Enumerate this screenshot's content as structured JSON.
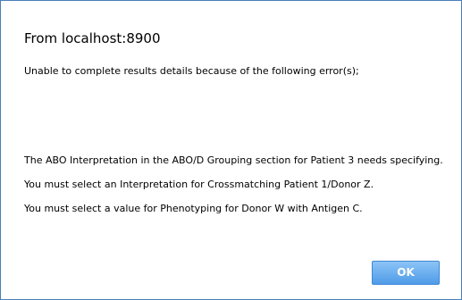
{
  "dialog": {
    "title": "From localhost:8900",
    "intro": "Unable to complete results details because of the following error(s);",
    "errors": [
      "The ABO Interpretation in the ABO/D Grouping section for Patient 3 needs specifying.",
      "You must select an Interpretation for Crossmatching Patient 1/Donor Z.",
      "You must select a value for Phenotyping for Donor W with Antigen C."
    ],
    "ok_label": "OK"
  },
  "colors": {
    "border": "#4a7fb8",
    "button_top": "#8cc4f6",
    "button_bottom": "#4f9be8",
    "button_text": "#ffffff"
  }
}
